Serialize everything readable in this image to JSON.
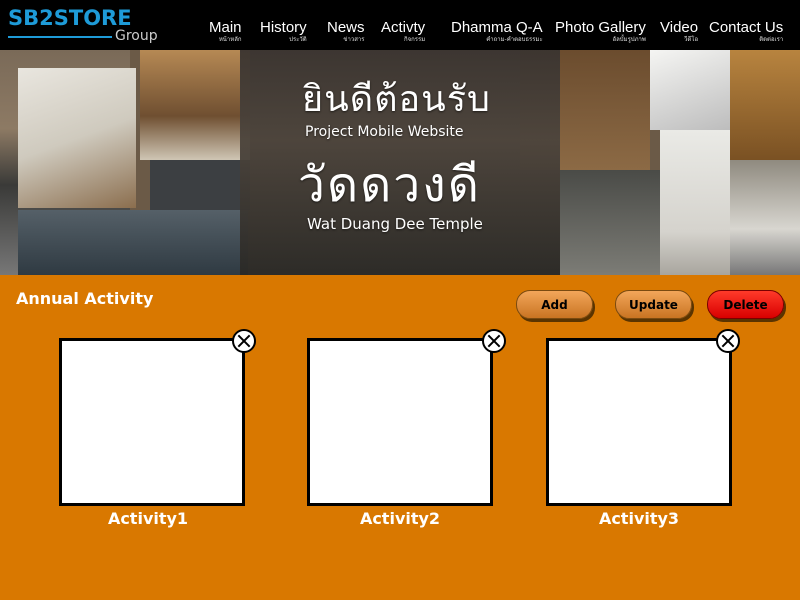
{
  "logo": {
    "main": "SB2STORE",
    "sub": "Group"
  },
  "nav": [
    {
      "label": "Main",
      "sub": "หน้าหลัก"
    },
    {
      "label": "History",
      "sub": "ประวัติ"
    },
    {
      "label": "News",
      "sub": "ข่าวสาร"
    },
    {
      "label": "Activty",
      "sub": "กิจกรรม"
    },
    {
      "label": "Dhamma Q-A",
      "sub": "คำถาม-คำตอบธรรมะ"
    },
    {
      "label": "Photo Gallery",
      "sub": "อัลบั้มรูปภาพ"
    },
    {
      "label": "Video",
      "sub": "วีดีโอ"
    },
    {
      "label": "Contact Us",
      "sub": "ติดต่อเรา"
    }
  ],
  "banner": {
    "welcome_th": "ยินดีต้อนรับ",
    "welcome_en": "Project Mobile Website",
    "temple_th": "วัดดวงดี",
    "temple_en": "Wat Duang Dee Temple"
  },
  "main": {
    "title": "Annual Activity",
    "buttons": {
      "add": "Add",
      "update": "Update",
      "delete": "Delete"
    },
    "activities": [
      {
        "label": "Activity1"
      },
      {
        "label": "Activity2"
      },
      {
        "label": "Activity3"
      }
    ]
  },
  "colors": {
    "background": "#d97800",
    "header": "#000000",
    "logo": "#1e9bd8",
    "button_orange": "#e08a3a",
    "button_delete": "#ff1a0a"
  }
}
